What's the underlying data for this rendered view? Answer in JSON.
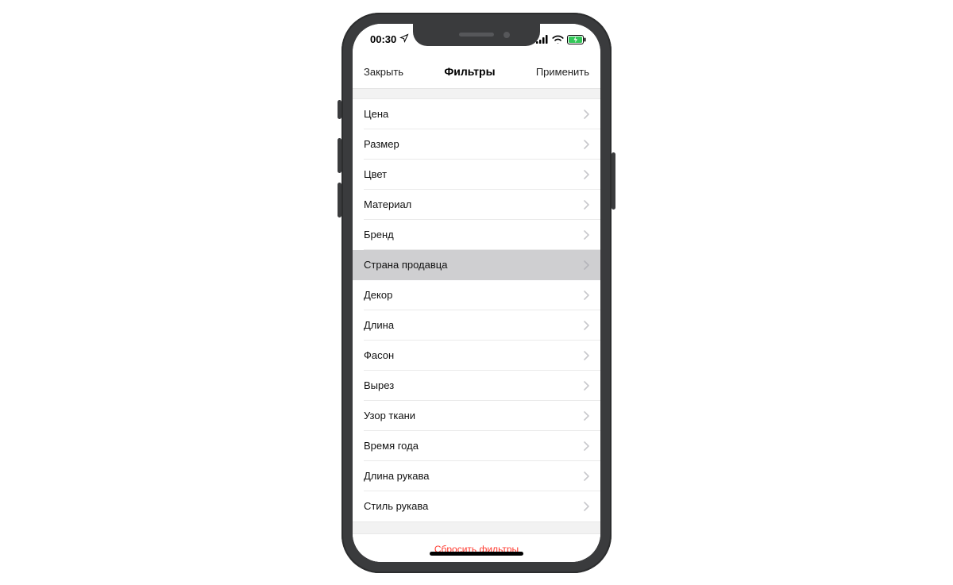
{
  "status": {
    "time": "00:30"
  },
  "nav": {
    "close": "Закрыть",
    "title": "Фильтры",
    "apply": "Применить"
  },
  "filters": {
    "items": [
      {
        "label": "Цена",
        "selected": false
      },
      {
        "label": "Размер",
        "selected": false
      },
      {
        "label": "Цвет",
        "selected": false
      },
      {
        "label": "Материал",
        "selected": false
      },
      {
        "label": "Бренд",
        "selected": false
      },
      {
        "label": "Страна продавца",
        "selected": true
      },
      {
        "label": "Декор",
        "selected": false
      },
      {
        "label": "Длина",
        "selected": false
      },
      {
        "label": "Фасон",
        "selected": false
      },
      {
        "label": "Вырез",
        "selected": false
      },
      {
        "label": "Узор ткани",
        "selected": false
      },
      {
        "label": "Время года",
        "selected": false
      },
      {
        "label": "Длина рукава",
        "selected": false
      },
      {
        "label": "Стиль рукава",
        "selected": false
      }
    ]
  },
  "actions": {
    "reset": "Сбросить фильтры"
  }
}
